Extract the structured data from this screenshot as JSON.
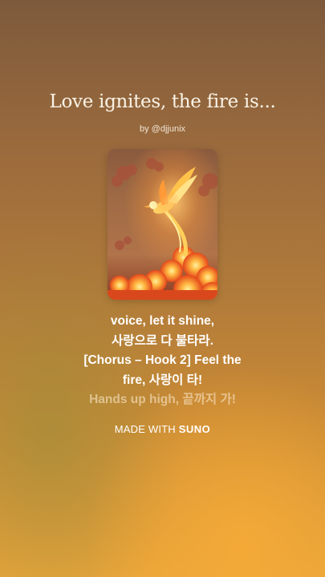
{
  "song": {
    "title": "Love ignites, the fire is...",
    "byline": "by @djjunix"
  },
  "cover": {
    "icon": "phoenix-artwork"
  },
  "lyrics": {
    "lines": [
      "voice, let it shine,",
      "사랑으로 다 불타라.",
      "[Chorus – Hook 2] Feel the",
      "fire, 사랑이 타!",
      "Hands up high, 끝까지 가!"
    ]
  },
  "footer": {
    "made_with": "MADE WITH",
    "brand": "SUNO"
  },
  "colors": {
    "background_top": "#7d5a3c",
    "background_bottom": "#e8a53a",
    "text": "#ffffff"
  }
}
